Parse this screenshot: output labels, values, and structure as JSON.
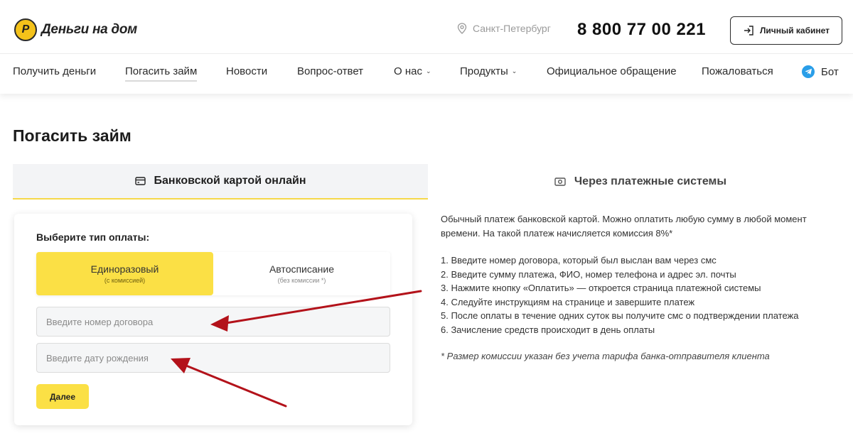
{
  "header": {
    "logo_mark": "Р",
    "logo_text": "Деньги на дом",
    "city": "Санкт-Петербург",
    "phone": "8 800 77 00 221",
    "cabinet_label": "Личный кабинет"
  },
  "nav": {
    "items": [
      {
        "label": "Получить деньги"
      },
      {
        "label": "Погасить займ"
      },
      {
        "label": "Новости"
      },
      {
        "label": "Вопрос-ответ"
      },
      {
        "label": "О нас"
      },
      {
        "label": "Продукты"
      },
      {
        "label": "Официальное обращение"
      },
      {
        "label": "Пожаловаться"
      },
      {
        "label": "Бот"
      }
    ]
  },
  "page": {
    "title": "Погасить займ"
  },
  "tabs": {
    "card": "Банковской картой онлайн",
    "systems": "Через платежные системы"
  },
  "form": {
    "label": "Выберите тип оплаты:",
    "options": [
      {
        "main": "Единоразовый",
        "sub": "(с комиссией)"
      },
      {
        "main": "Автосписание",
        "sub": "(без комиссии *)"
      }
    ],
    "contract_placeholder": "Введите номер договора",
    "birth_placeholder": "Введите дату рождения",
    "next_label": "Далее"
  },
  "info": {
    "intro1": "Обычный платеж банковской картой. Можно оплатить любую сумму в любой момент",
    "intro2": "времени. На такой платеж начисляется комиссия 8%*",
    "steps": [
      "1. Введите номер договора, который был выслан вам через смс",
      "2. Введите сумму платежа, ФИО, номер телефона и адрес эл. почты",
      "3. Нажмите кнопку «Оплатить» — откроется страница платежной системы",
      "4. Следуйте инструкциям на странице и завершите платеж",
      "5. После оплаты в течение одних суток вы получите смс о подтверждении платежа",
      "6. Зачисление средств происходит в день оплаты"
    ],
    "note": "* Размер комиссии указан без учета тарифа банка-отправителя клиента"
  },
  "colors": {
    "accent": "#fbe045",
    "arrow": "#b3121a",
    "telegram": "#2a9ee8"
  }
}
